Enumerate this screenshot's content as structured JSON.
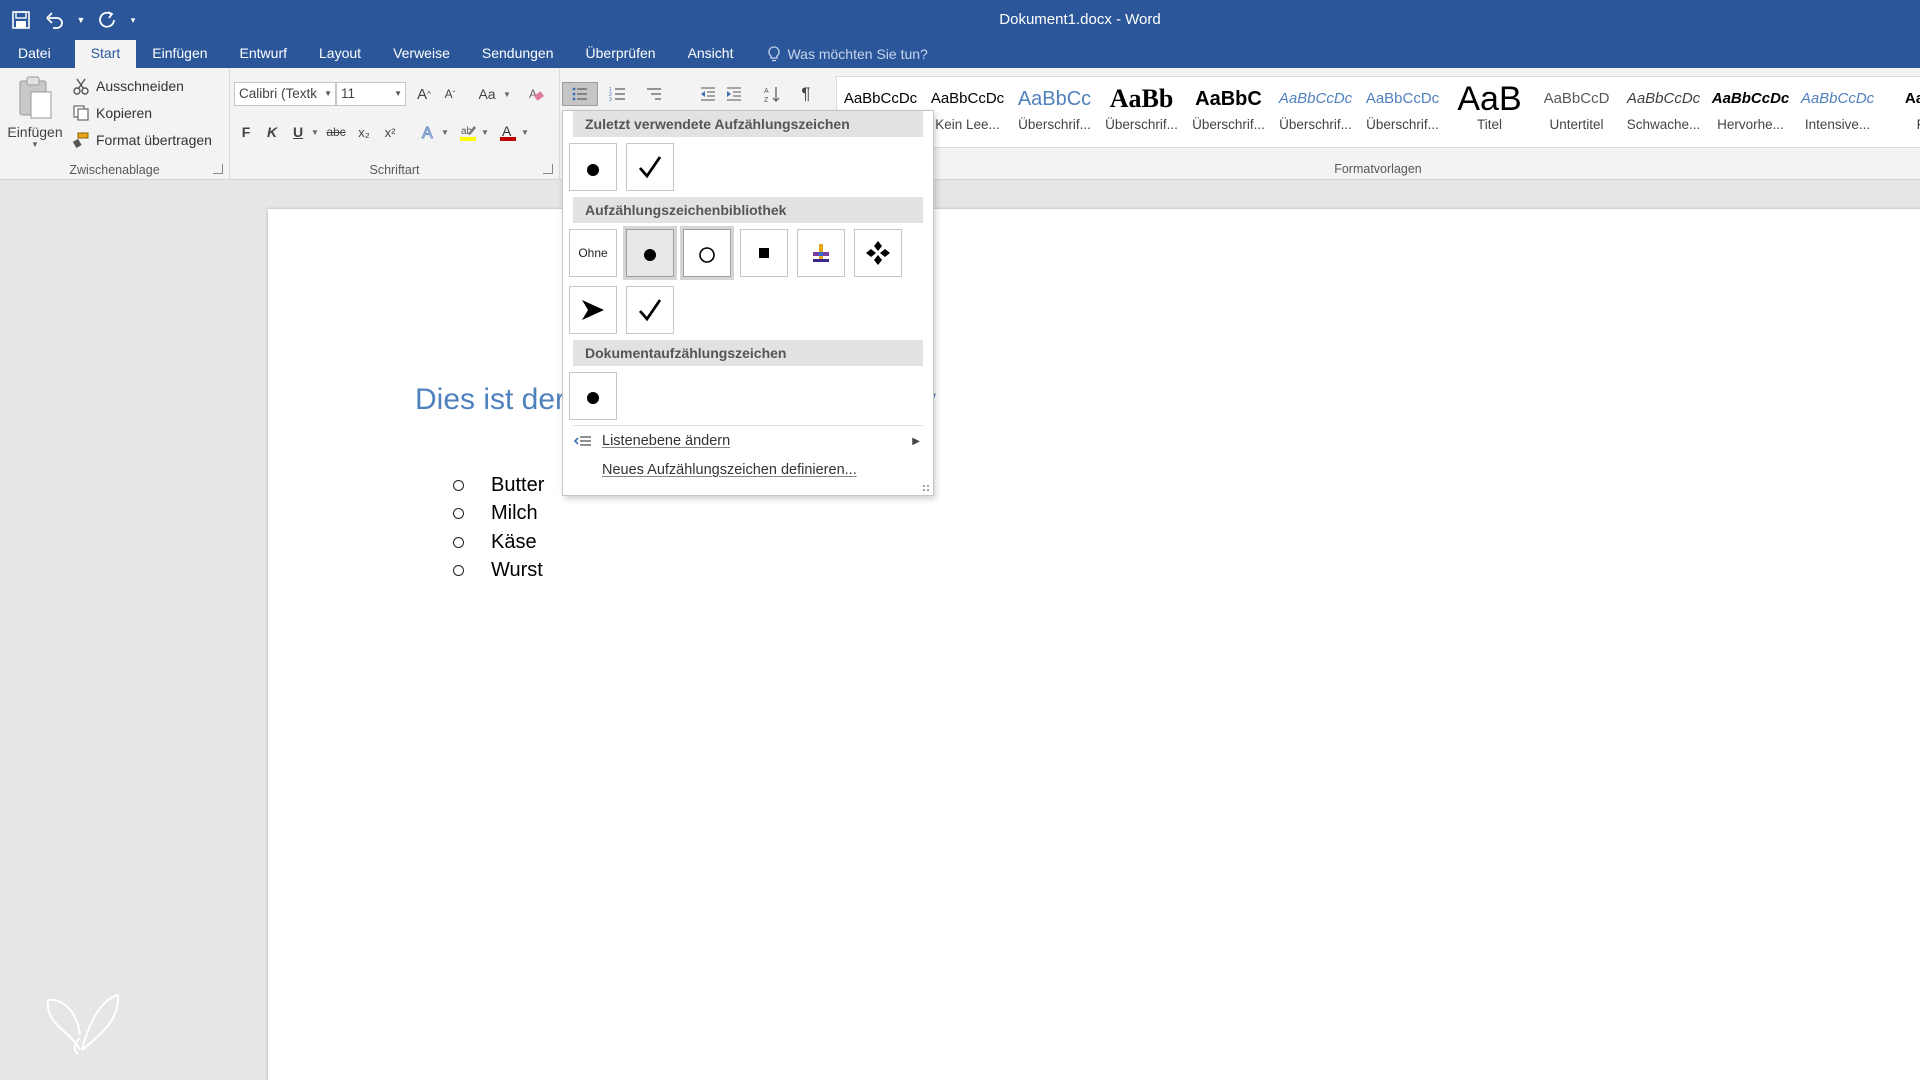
{
  "window": {
    "title": "Dokument1.docx - Word"
  },
  "tabs": [
    "Datei",
    "Start",
    "Einfügen",
    "Entwurf",
    "Layout",
    "Verweise",
    "Sendungen",
    "Überprüfen",
    "Ansicht"
  ],
  "active_tab": "Start",
  "tell_me": {
    "placeholder": "Was möchten Sie tun?"
  },
  "clipboard": {
    "group_label": "Zwischenablage",
    "paste": "Einfügen",
    "cut": "Ausschneiden",
    "copy": "Kopieren",
    "format_painter": "Format übertragen"
  },
  "font": {
    "group_label": "Schriftart",
    "family": "Calibri (Textk",
    "size": "11",
    "bold": "F",
    "italic": "K",
    "underline": "U",
    "strike": "abc",
    "subscript": "x₂",
    "superscript": "x²",
    "change_case": "Aa",
    "grow": "A",
    "shrink": "A"
  },
  "styles": {
    "group_label": "Formatvorlagen",
    "items": [
      {
        "preview": "AaBbCcDc",
        "name": "",
        "color": "#000000"
      },
      {
        "preview": "AaBbCcDc",
        "name": "Kein Lee...",
        "color": "#000000"
      },
      {
        "preview": "AaBbCc",
        "name": "Überschrif...",
        "color": "#4f81bd"
      },
      {
        "preview": "AaBb",
        "name": "Überschrif...",
        "color": "#000000"
      },
      {
        "preview": "AaBbC",
        "name": "Überschrif...",
        "color": "#000000"
      },
      {
        "preview": "AaBbCcDc",
        "name": "Überschrif...",
        "color": "#4f81bd"
      },
      {
        "preview": "AaBbCcDc",
        "name": "Überschrif...",
        "color": "#4f81bd"
      },
      {
        "preview": "AaB",
        "name": "Titel",
        "color": "#000000"
      },
      {
        "preview": "AaBbCcD",
        "name": "Untertitel",
        "color": "#595959"
      },
      {
        "preview": "AaBbCcDc",
        "name": "Schwache...",
        "color": "#404040"
      },
      {
        "preview": "AaBbCcDc",
        "name": "Hervorhe...",
        "color": "#000000"
      },
      {
        "preview": "AaBbCcDc",
        "name": "Intensive...",
        "color": "#4f81bd"
      },
      {
        "preview": "AaBb",
        "name": "Fe",
        "color": "#000000"
      }
    ]
  },
  "bullet_menu": {
    "recent_title": "Zuletzt verwendete Aufzählungszeichen",
    "library_title": "Aufzählungszeichenbibliothek",
    "document_title": "Dokumentaufzählungszeichen",
    "none_label": "Ohne",
    "change_level": "Listenebene ändern",
    "define_new": "Neues Aufzählungszeichen definieren..."
  },
  "document": {
    "heading": "Dies ist der",
    "heading_tail": "y",
    "list": [
      "Butter",
      "Milch",
      "Käse",
      "Wurst"
    ]
  },
  "colors": {
    "brand": "#2b579a",
    "heading": "#4f81bd",
    "font_color_bar": "#c00000",
    "highlight_bar": "#ffff00"
  }
}
